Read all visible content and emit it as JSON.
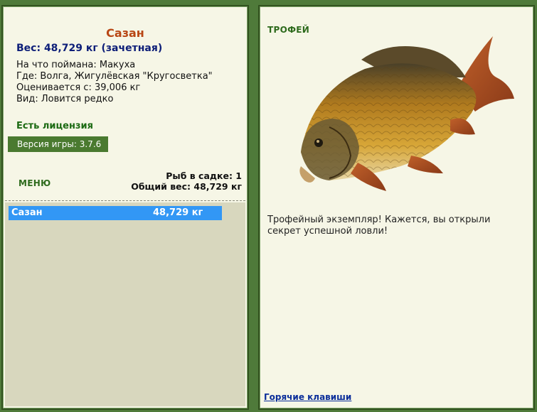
{
  "fish": {
    "title": "Сазан",
    "weight_line": "Вес: 48,729 кг (зачетная)",
    "bait_line": "На что поймана: Макуха",
    "place_line": "Где: Волга, Жигулёвская \"Кругосветка\"",
    "value_line": "Оценивается с: 39,006 кг",
    "kind_line": "Вид: Ловится редко"
  },
  "license": "Есть лицензия",
  "version": {
    "label": "Версия игры:",
    "value": "3.7.6"
  },
  "menu_label": "МЕНЮ",
  "keepnet": {
    "count_line": "Рыб в садке: 1",
    "total_line": "Общий вес: 48,729 кг"
  },
  "catch_list": [
    {
      "name": "Сазан",
      "weight": "48,729 кг"
    }
  ],
  "trophy": {
    "label": "ТРОФЕЙ",
    "text": "Трофейный экземпляр! Кажется, вы открыли секрет успешной ловли!",
    "image_icon": "carp-fish-icon"
  },
  "hotkeys_label": "Горячие клавиши",
  "colors": {
    "frame": "#4f7a3a",
    "panel_bg": "#f6f6e6",
    "title": "#b84614",
    "weight": "#0d1e78",
    "accent_green": "#2d6a1c",
    "list_selected": "#3297f5",
    "list_bg": "#d8d7be"
  }
}
